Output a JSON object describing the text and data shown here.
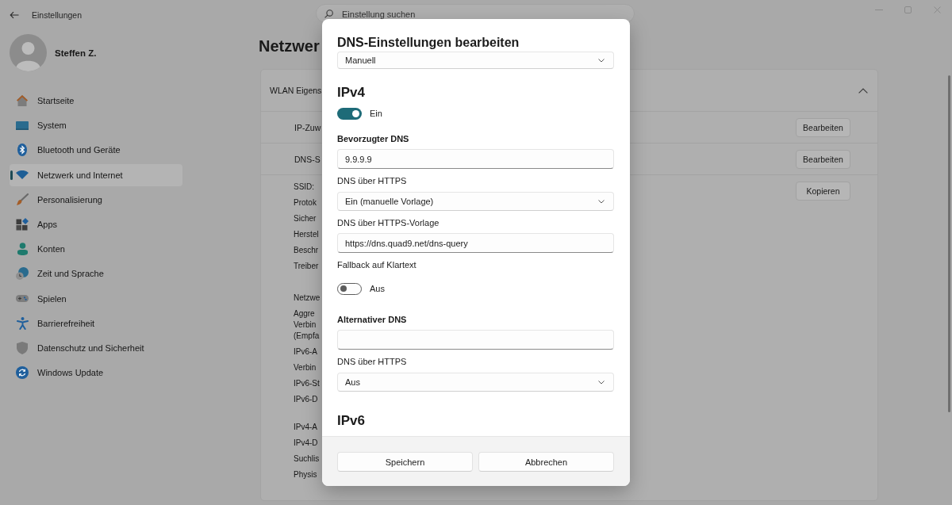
{
  "window": {
    "title": "Einstellungen"
  },
  "search": {
    "placeholder": "Einstellung suchen"
  },
  "user": {
    "name": "Steffen Z."
  },
  "sidebar": {
    "items": [
      {
        "label": "Startseite",
        "selected": false
      },
      {
        "label": "System",
        "selected": false
      },
      {
        "label": "Bluetooth und Geräte",
        "selected": false
      },
      {
        "label": "Netzwerk und Internet",
        "selected": true
      },
      {
        "label": "Personalisierung",
        "selected": false
      },
      {
        "label": "Apps",
        "selected": false
      },
      {
        "label": "Konten",
        "selected": false
      },
      {
        "label": "Zeit und Sprache",
        "selected": false
      },
      {
        "label": "Spielen",
        "selected": false
      },
      {
        "label": "Barrierefreiheit",
        "selected": false
      },
      {
        "label": "Datenschutz und Sicherheit",
        "selected": false
      },
      {
        "label": "Windows Update",
        "selected": false
      }
    ]
  },
  "page": {
    "title": "Netzwer"
  },
  "card": {
    "header": "WLAN Eigens",
    "expanded": true,
    "rows": [
      {
        "label": "IP-Zuw",
        "button": "Bearbeiten"
      },
      {
        "label": "DNS-S",
        "button": "Bearbeiten"
      }
    ],
    "details": {
      "button": "Kopieren",
      "groups": [
        [
          "SSID:",
          "Protok",
          "Sicher",
          "Herstel",
          "Beschr",
          "Treiber"
        ],
        [
          "Netzwe",
          "Aggre\nVerbin\n(Empfa",
          "IPv6-A",
          "Verbin",
          "IPv6-St",
          "IPv6-D"
        ],
        [
          "IPv4-A",
          "IPv4-D",
          "Suchlis",
          "Physis"
        ]
      ]
    }
  },
  "dialog": {
    "title": "DNS-Einstellungen bearbeiten",
    "content": [
      {
        "kind": "select",
        "value": "Manuell"
      },
      {
        "kind": "heading",
        "text": "IPv4"
      },
      {
        "kind": "toggle",
        "on": true,
        "text": "Ein"
      },
      {
        "kind": "group_label",
        "text": "Bevorzugter DNS"
      },
      {
        "kind": "input",
        "value": "9.9.9.9"
      },
      {
        "kind": "label",
        "text": "DNS über HTTPS"
      },
      {
        "kind": "select",
        "value": "Ein (manuelle Vorlage)"
      },
      {
        "kind": "label",
        "text": "DNS über HTTPS-Vorlage"
      },
      {
        "kind": "input",
        "value": "https://dns.quad9.net/dns-query"
      },
      {
        "kind": "label",
        "text": "Fallback auf Klartext"
      },
      {
        "kind": "toggle",
        "on": false,
        "text": "Aus"
      },
      {
        "kind": "group_label",
        "text": "Alternativer DNS"
      },
      {
        "kind": "input"
      },
      {
        "kind": "label",
        "text": "DNS über HTTPS"
      },
      {
        "kind": "select",
        "value": "Aus"
      },
      {
        "kind": "heading",
        "text": "IPv6"
      }
    ],
    "buttons": [
      "Speichern",
      "Abbrechen"
    ]
  }
}
